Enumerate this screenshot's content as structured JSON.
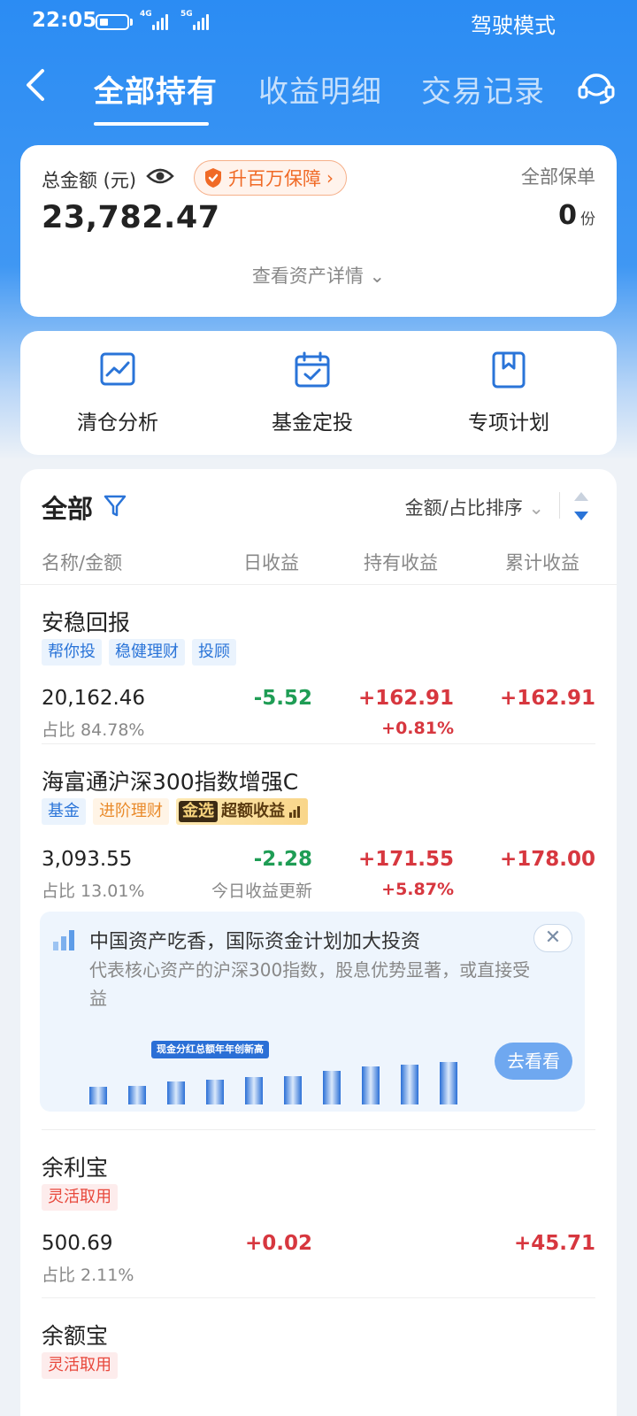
{
  "status": {
    "time": "22:05",
    "net1": "4G",
    "net2": "5G",
    "mode": "驾驶模式"
  },
  "nav": {
    "tabs": [
      "全部持有",
      "收益明细",
      "交易记录"
    ]
  },
  "summary": {
    "total_label": "总金额 (元)",
    "promo": "升百万保障",
    "amount": "23,782.47",
    "policy_label": "全部保单",
    "policy_count": "0",
    "policy_unit": "份",
    "detail": "查看资产详情"
  },
  "actions": [
    "清仓分析",
    "基金定投",
    "专项计划"
  ],
  "list": {
    "title": "全部",
    "sort": "金额/占比排序",
    "headers": [
      "名称/金额",
      "日收益",
      "持有收益",
      "累计收益"
    ],
    "items": [
      {
        "name": "安稳回报",
        "tags": [
          "帮你投",
          "稳健理财",
          "投顾"
        ],
        "amount": "20,162.46",
        "ratio": "占比 84.78%",
        "daily": "-5.52",
        "hold": "+162.91",
        "hold_pct": "+0.81%",
        "total": "+162.91"
      },
      {
        "name": "海富通沪深300指数增强C",
        "tags": [
          "基金",
          "进阶理财"
        ],
        "gold_badge": "金选",
        "gold_text": "超额收益",
        "amount": "3,093.55",
        "ratio": "占比 13.01%",
        "daily": "-2.28",
        "daily_note": "今日收益更新",
        "hold": "+171.55",
        "hold_pct": "+5.87%",
        "total": "+178.00"
      },
      {
        "name": "余利宝",
        "tags": [
          "灵活取用"
        ],
        "amount": "500.69",
        "ratio": "占比 2.11%",
        "daily": "+0.02",
        "total": "+45.71"
      },
      {
        "name": "余额宝",
        "tags": [
          "灵活取用"
        ]
      }
    ]
  },
  "banner": {
    "title": "中国资产吃香，国际资金计划加大投资",
    "text": "代表核心资产的沪深300指数，股息优势显著，或直接受益",
    "chart_caption": "现金分红总额年年创新高",
    "button": "去看看",
    "close": "✕"
  }
}
